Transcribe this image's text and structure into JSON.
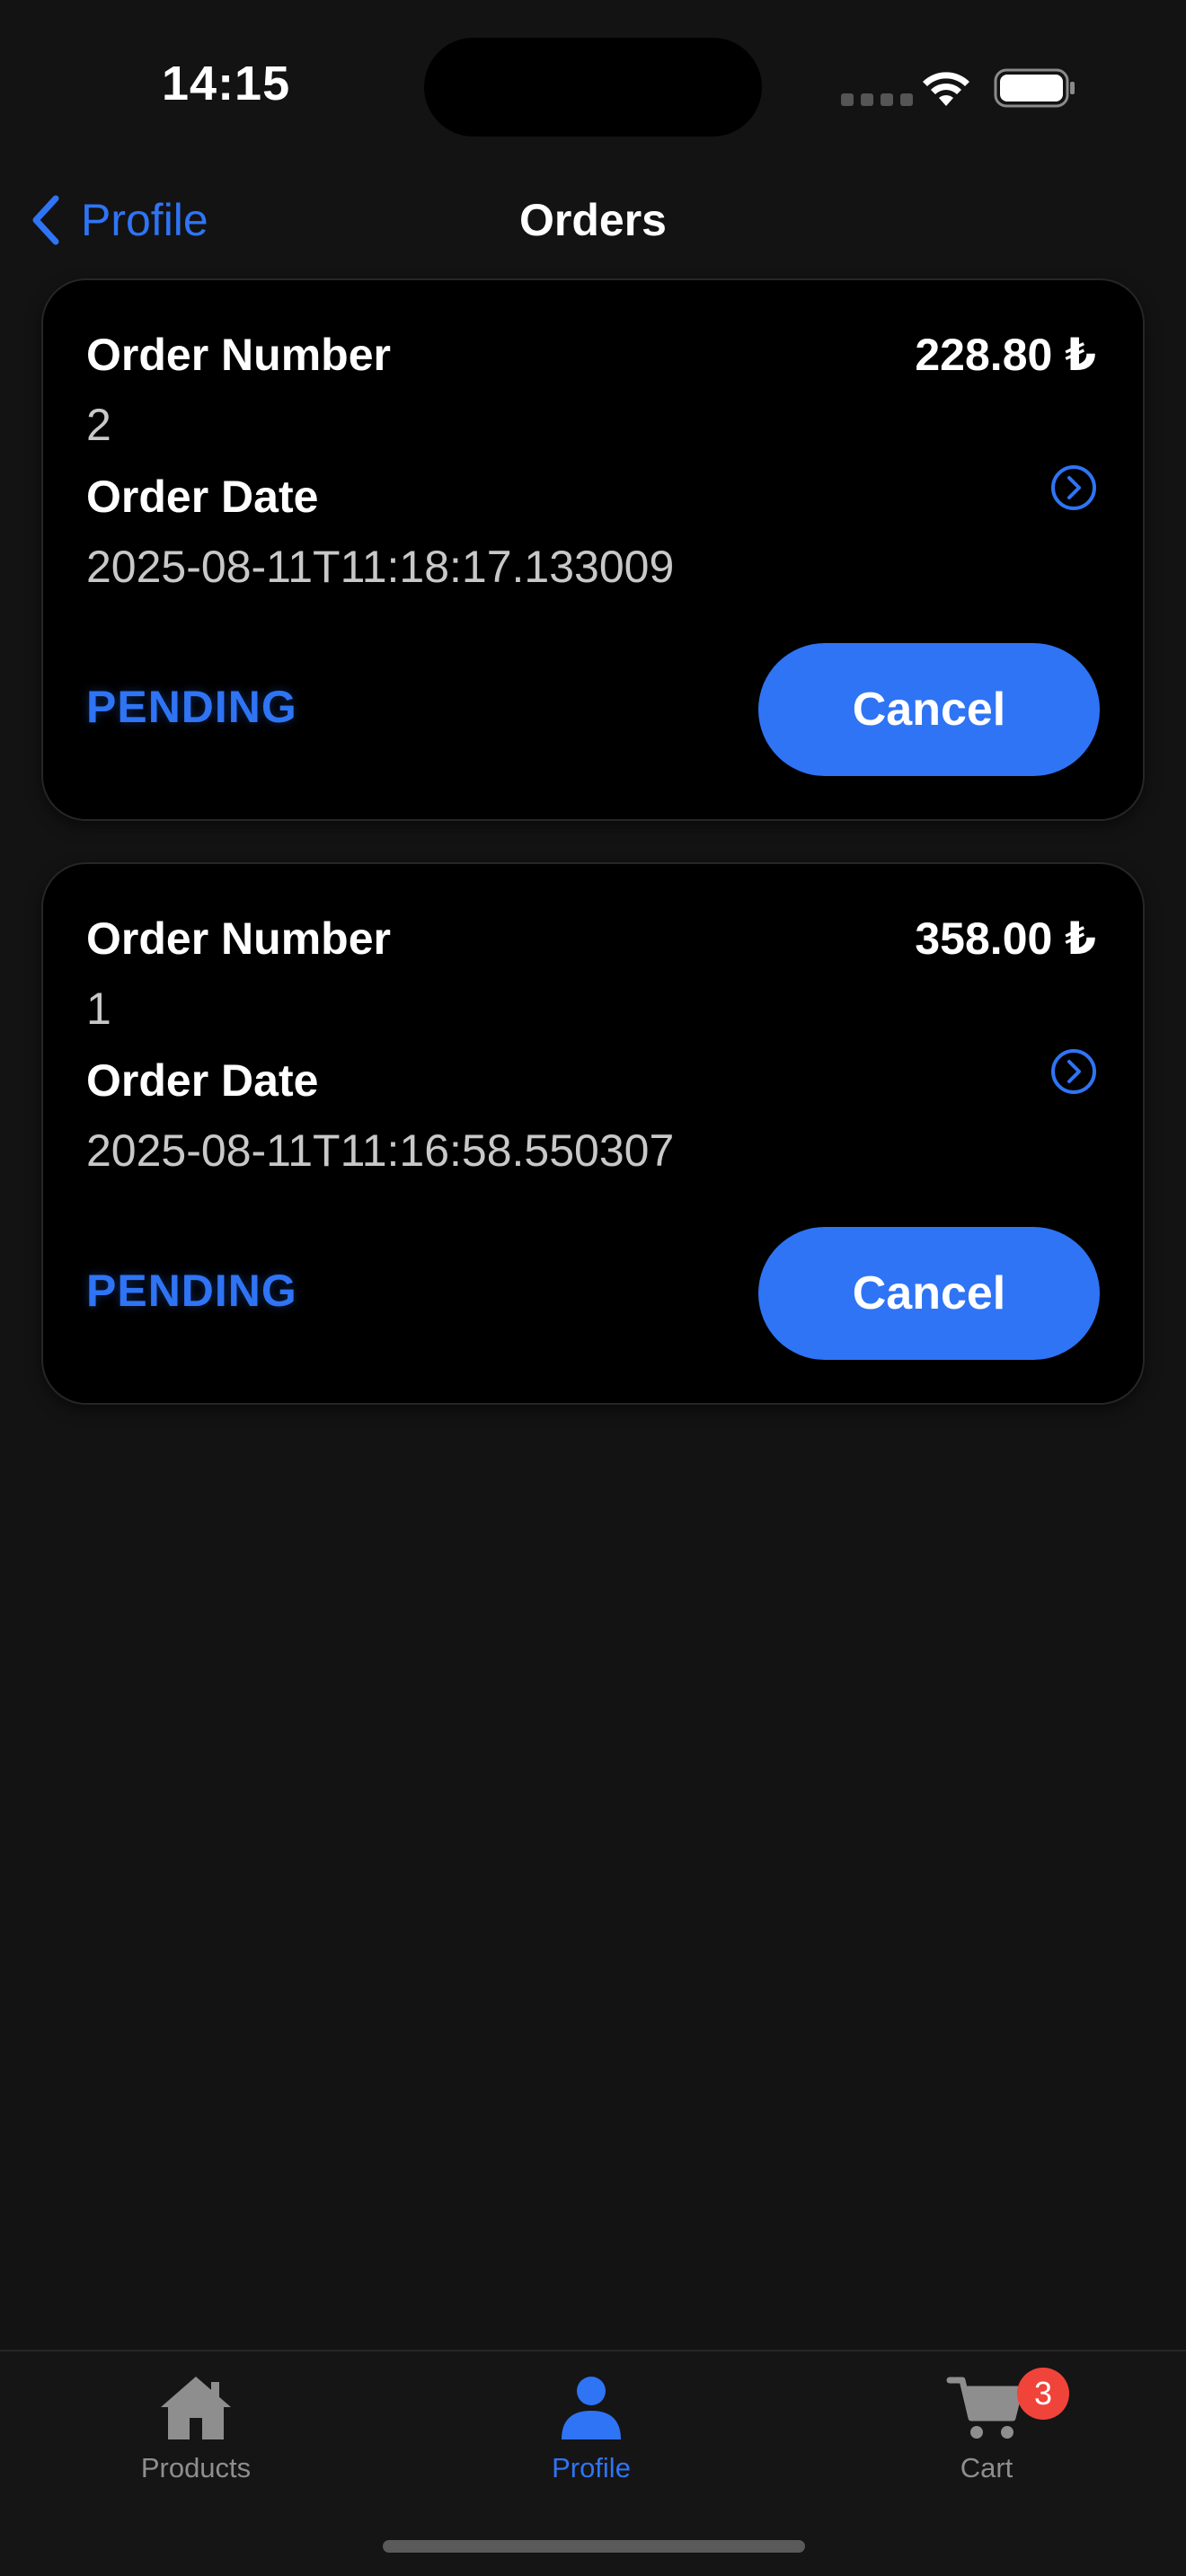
{
  "status_bar": {
    "time": "14:15"
  },
  "nav": {
    "back_label": "Profile",
    "title": "Orders"
  },
  "orders": [
    {
      "number_label": "Order Number",
      "number": "2",
      "date_label": "Order Date",
      "date": "2025-08-11T11:18:17.133009",
      "total": "228.80 ₺",
      "status": "PENDING",
      "cancel_label": "Cancel"
    },
    {
      "number_label": "Order Number",
      "number": "1",
      "date_label": "Order Date",
      "date": "2025-08-11T11:16:58.550307",
      "total": "358.00 ₺",
      "status": "PENDING",
      "cancel_label": "Cancel"
    }
  ],
  "tab_bar": {
    "items": [
      {
        "label": "Products",
        "icon": "house-icon",
        "active": false
      },
      {
        "label": "Profile",
        "icon": "person-icon",
        "active": true
      },
      {
        "label": "Cart",
        "icon": "cart-icon",
        "active": false
      }
    ],
    "cart_badge": "3"
  },
  "colors": {
    "accent": "#2f74f5",
    "background": "#131313",
    "card": "#000000",
    "badge": "#f0443a"
  }
}
